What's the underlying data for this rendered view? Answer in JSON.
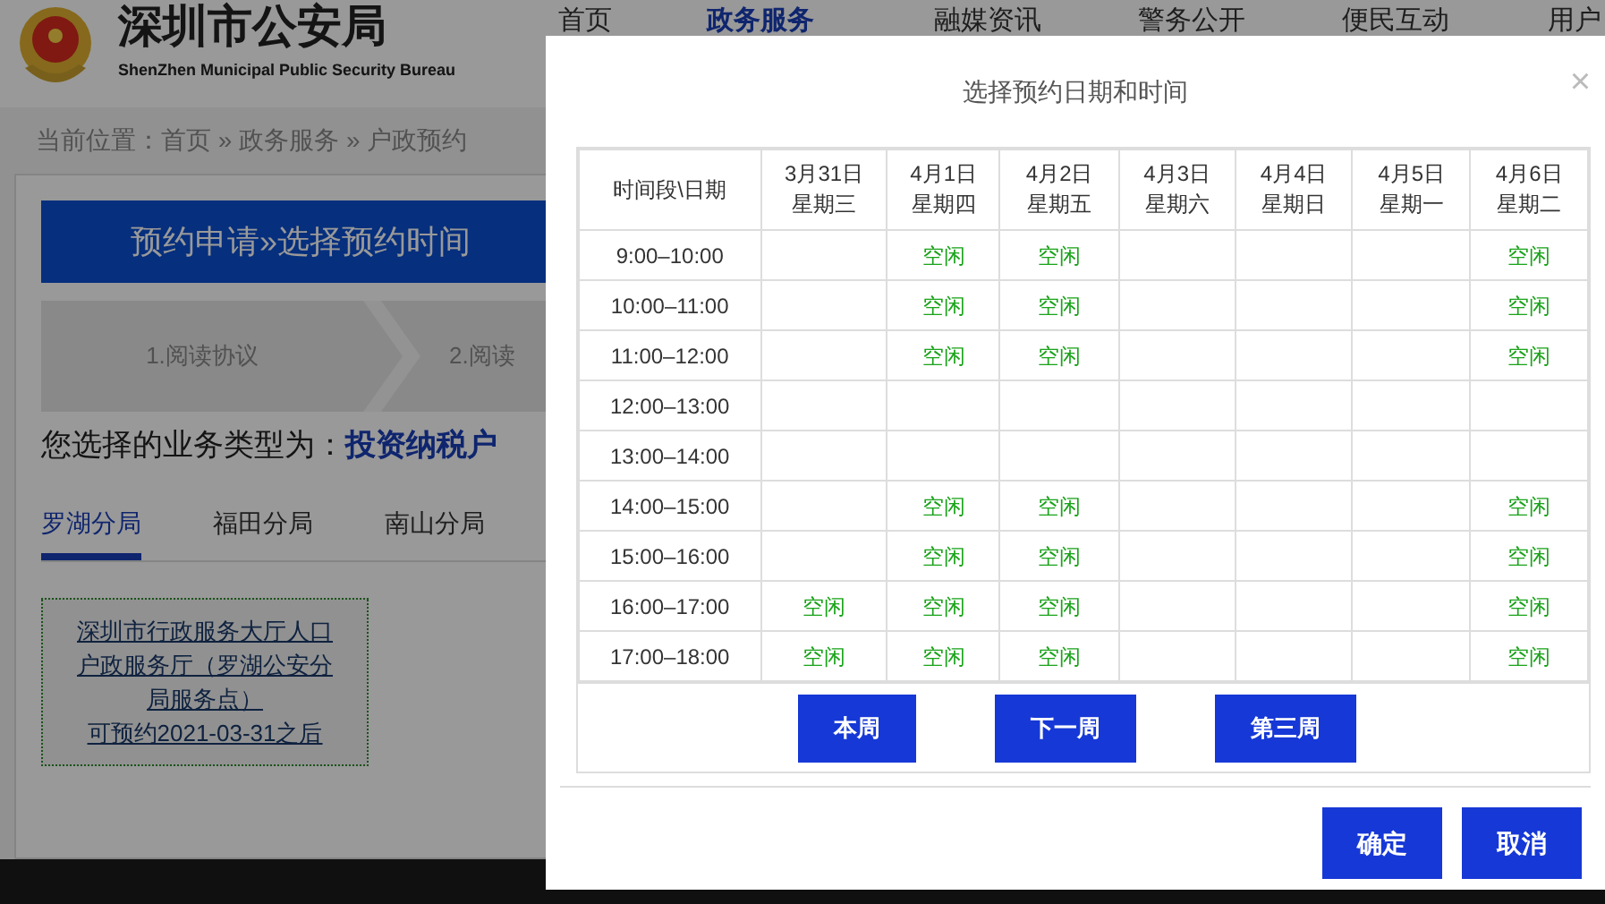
{
  "header": {
    "title": "深圳市公安局",
    "subtitle": "ShenZhen Municipal Public Security Bureau",
    "nav": [
      {
        "label": "首页",
        "selected": false
      },
      {
        "label": "政务服务",
        "selected": true
      },
      {
        "label": "融媒资讯",
        "selected": false
      },
      {
        "label": "警务公开",
        "selected": false
      },
      {
        "label": "便民互动",
        "selected": false
      },
      {
        "label": "用户",
        "selected": false
      }
    ]
  },
  "breadcrumb": "当前位置：首页 » 政务服务 » 户政预约",
  "banner": "预约申请»选择预约时间",
  "steps": [
    "1.阅读协议",
    "2.阅读"
  ],
  "business": {
    "label": "您选择的业务类型为：",
    "value": "投资纳税户"
  },
  "branch_tabs": [
    {
      "label": "罗湖分局",
      "selected": true
    },
    {
      "label": "福田分局",
      "selected": false
    },
    {
      "label": "南山分局",
      "selected": false
    }
  ],
  "service_point": {
    "lines": [
      "深圳市行政服务大厅人口",
      "户政服务厅（罗湖公安分",
      "局服务点）",
      "可预约2021-03-31之后"
    ]
  },
  "dialog": {
    "title": "选择预约日期和时间",
    "close": "×",
    "columns": [
      {
        "date": "时间段\\日期"
      },
      {
        "date": "3月31日",
        "weekday": "星期三"
      },
      {
        "date": "4月1日",
        "weekday": "星期四"
      },
      {
        "date": "4月2日",
        "weekday": "星期五"
      },
      {
        "date": "4月3日",
        "weekday": "星期六"
      },
      {
        "date": "4月4日",
        "weekday": "星期日"
      },
      {
        "date": "4月5日",
        "weekday": "星期一"
      },
      {
        "date": "4月6日",
        "weekday": "星期二"
      }
    ],
    "rows": [
      {
        "cells": [
          "9:00–10:00",
          null,
          "空闲",
          "空闲",
          null,
          null,
          null,
          "空闲"
        ]
      },
      {
        "cells": [
          "10:00–11:00",
          null,
          "空闲",
          "空闲",
          null,
          null,
          null,
          "空闲"
        ]
      },
      {
        "cells": [
          "11:00–12:00",
          null,
          "空闲",
          "空闲",
          null,
          null,
          null,
          "空闲"
        ]
      },
      {
        "cells": [
          "12:00–13:00",
          null,
          null,
          null,
          null,
          null,
          null,
          null
        ]
      },
      {
        "cells": [
          "13:00–14:00",
          null,
          null,
          null,
          null,
          null,
          null,
          null
        ]
      },
      {
        "cells": [
          "14:00–15:00",
          null,
          "空闲",
          "空闲",
          null,
          null,
          null,
          "空闲"
        ]
      },
      {
        "cells": [
          "15:00–16:00",
          null,
          "空闲",
          "空闲",
          null,
          null,
          null,
          "空闲"
        ]
      },
      {
        "cells": [
          "16:00–17:00",
          "空闲",
          "空闲",
          "空闲",
          null,
          null,
          null,
          "空闲"
        ]
      },
      {
        "cells": [
          "17:00–18:00",
          "空闲",
          "空闲",
          "空闲",
          null,
          null,
          null,
          "空闲"
        ]
      }
    ],
    "week_buttons": [
      "本周",
      "下一周",
      "第三周"
    ],
    "buttons": [
      "确定",
      "取消"
    ]
  }
}
